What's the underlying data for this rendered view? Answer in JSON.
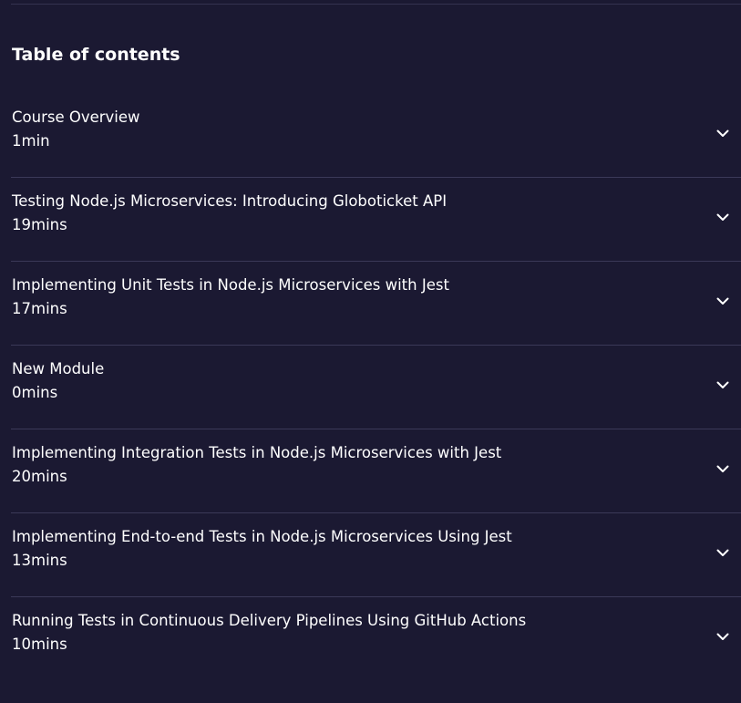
{
  "toc": {
    "title": "Table of contents",
    "modules": [
      {
        "title": "Course Overview",
        "duration": "1min"
      },
      {
        "title": "Testing Node.js Microservices: Introducing Globoticket API",
        "duration": "19mins"
      },
      {
        "title": "Implementing Unit Tests in Node.js Microservices with Jest",
        "duration": "17mins"
      },
      {
        "title": "New Module",
        "duration": "0mins"
      },
      {
        "title": "Implementing Integration Tests in Node.js Microservices with Jest",
        "duration": "20mins"
      },
      {
        "title": "Implementing End-to-end Tests in Node.js Microservices Using Jest",
        "duration": "13mins"
      },
      {
        "title": "Running Tests in Continuous Delivery Pipelines Using GitHub Actions",
        "duration": "10mins"
      }
    ],
    "expand_icon": "chevron-down-icon"
  },
  "colors": {
    "background": "#1b1932",
    "divider": "#3b3958",
    "text": "#ffffff"
  }
}
